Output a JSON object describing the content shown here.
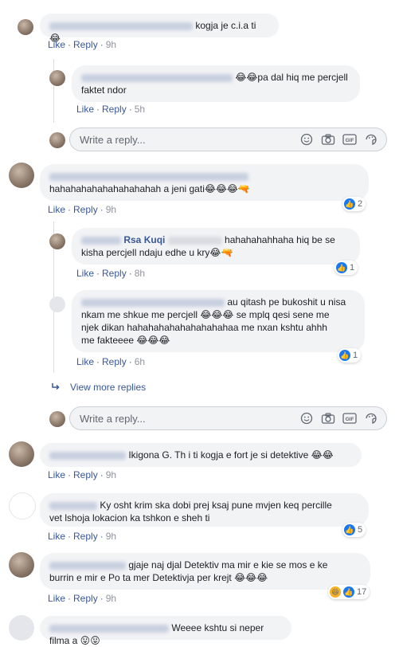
{
  "actions": {
    "like": "Like",
    "reply": "Reply"
  },
  "reply_placeholder": "Write a reply...",
  "view_more": "View more replies",
  "comments": [
    {
      "text": "kogja je c.i.a ti 😂",
      "time": "9h"
    },
    {
      "text": "pa dal hiq me percjell faktet ndor",
      "prefix": "😂😂",
      "time": "5h"
    },
    {
      "text": "hahahahahahahahahahah a jeni gati😂😂😂🔫",
      "time": "9h",
      "reactions": "2"
    },
    {
      "name_visible": "Rsa Kuqi",
      "text": "hahahahahhaha hiq be se kisha percjell ndaju edhe u kry😂🔫",
      "time": "8h",
      "reactions": "1"
    },
    {
      "line1": "au qitash pe bukoshit u nisa",
      "line2": "nkam me shkue me percjell 😂😂😂 se mplq qesi sene me",
      "line3": "njek dikan hahahahahahahahahahaa me nxan kshtu ahhh",
      "line4": "me fakteeee 😂😂😂",
      "time": "6h",
      "reactions": "1"
    },
    {
      "name_tail": "Ikigona G. Th",
      "text": "i ti kogja e fort je si detektive 😂😂",
      "time": "9h"
    },
    {
      "line1": "Ky osht krim ska dobi prej ksaj pune mvjen keq percille",
      "line2": "vet lshoja lokacion ka tshkon e sheh ti",
      "time": "9h",
      "reactions": "5"
    },
    {
      "line1": "gjaje naj djal Detektiv ma mir e kie se mos e ke",
      "line2": "burrin e mir e Po ta mer Detektivja per krejt 😂😂😂",
      "time": "9h",
      "reactions": "17"
    },
    {
      "text": "Weeee kshtu si neper filma a 😛😛"
    }
  ]
}
